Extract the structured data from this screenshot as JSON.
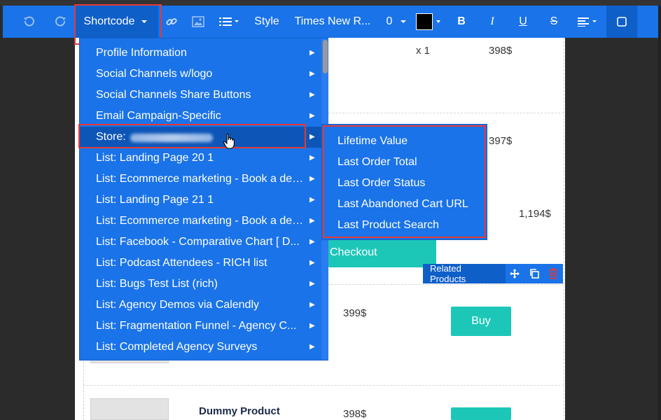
{
  "toolbar": {
    "shortcode_label": "Shortcode",
    "style_label": "Style",
    "font_label": "Times New R...",
    "size_label": "0",
    "text_color": "#000000",
    "bold_label": "B",
    "italic_label": "I",
    "underline_label": "U",
    "strike_label": "S",
    "icons": [
      "undo-icon",
      "redo-icon",
      "link-icon",
      "image-icon",
      "list-icon",
      "align-icon",
      "checkbox-icon"
    ]
  },
  "menu": {
    "items": [
      {
        "label": "Profile Information"
      },
      {
        "label": "Social Channels w/logo"
      },
      {
        "label": "Social Channels Share Buttons"
      },
      {
        "label": "Email Campaign-Specific"
      },
      {
        "label": "Store:"
      },
      {
        "label": "List: Landing Page 20 1"
      },
      {
        "label": "List: Ecommerce marketing - Book a demo"
      },
      {
        "label": "List: Landing Page 21 1"
      },
      {
        "label": "List: Ecommerce marketing - Book a demo"
      },
      {
        "label": "List: Facebook - Comparative Chart [ D..."
      },
      {
        "label": "List: Podcast Attendees - RICH list"
      },
      {
        "label": "List: Bugs Test List (rich)"
      },
      {
        "label": "List: Agency Demos via Calendly"
      },
      {
        "label": "List: Fragmentation Funnel - Agency C..."
      },
      {
        "label": "List: Completed Agency Surveys"
      }
    ],
    "active_index": 4
  },
  "submenu": {
    "items": [
      "Lifetime Value",
      "Last Order Total",
      "Last Order Status",
      "Last Abandoned Cart URL",
      "Last Product Search"
    ]
  },
  "page": {
    "qty": "x 1",
    "price1": "398$",
    "price2": "397$",
    "total": "1,194$",
    "checkout_label": "Checkout",
    "related_label": "Related Products",
    "price3": "399$",
    "buy_label": "Buy",
    "product_name": "Dummy Product",
    "price4": "398$"
  }
}
